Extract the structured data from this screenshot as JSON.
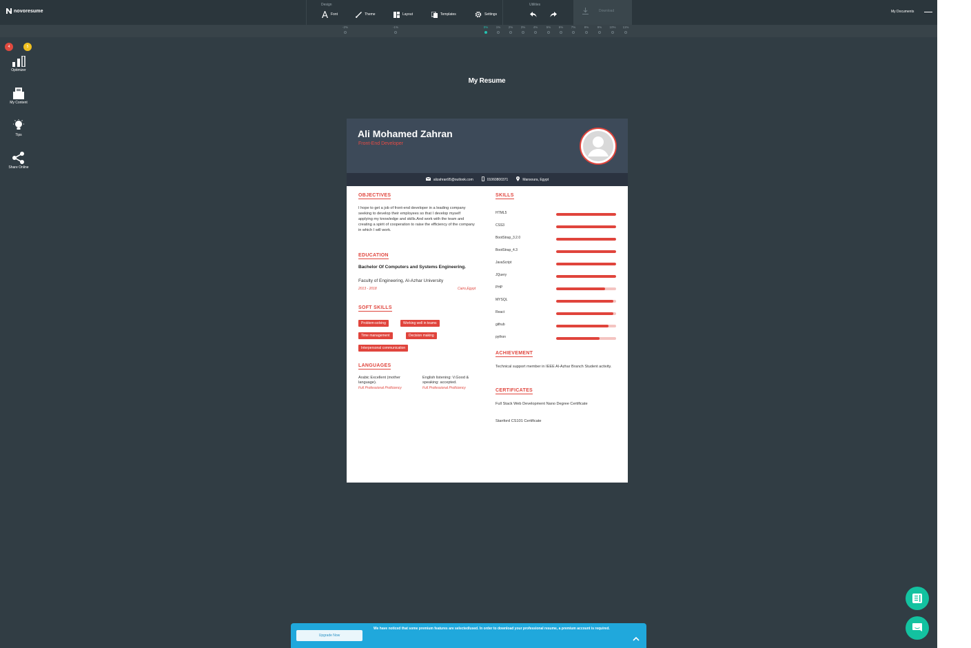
{
  "app": {
    "brand": "novoresume"
  },
  "toolbar": {
    "design_label": "Design",
    "design_items": [
      "Font",
      "Theme",
      "Layout",
      "Templates",
      "Settings"
    ],
    "utilities_label": "Utilities",
    "download_label": "Download",
    "my_documents": "My Documents"
  },
  "spacing_scale": {
    "left_values": [
      "-2%",
      "-1%"
    ],
    "values": [
      "0%",
      "1%",
      "2%",
      "3%",
      "4%",
      "5%",
      "6%",
      "7%",
      "8%",
      "9%",
      "10%",
      "11%"
    ],
    "active_value": "0%"
  },
  "sidebar": {
    "badges": {
      "red": "4",
      "yellow": "5"
    },
    "items": [
      {
        "label": "Optimizer",
        "icon": "bar-chart-icon"
      },
      {
        "label": "My Content",
        "icon": "folder-icon"
      },
      {
        "label": "Tips",
        "icon": "lightbulb-icon"
      },
      {
        "label": "Share Online",
        "icon": "share-icon"
      }
    ]
  },
  "document": {
    "title": "My Resume"
  },
  "resume": {
    "name": "Ali Mohamed Zahran",
    "role": "Front-End Developer",
    "contact": {
      "email": "alizahran95@outlook.com",
      "phone": "01060800371",
      "location": "Mansoura, Egypt"
    },
    "objectives_title": "OBJECTIVES",
    "objectives_text": "I hope to get a job of front-end developer in a leading company seeking to develop their employees so that I develop myself applying my knowledge and skills.And work with the team and creating a spirit of cooperation to raise the efficiency of the company in which I will work.",
    "education_title": "EDUCATION",
    "education": {
      "degree": "Bachelor Of Computers and Systems Engineering.",
      "school": "Faculty of Engineering, Al-Azhar University",
      "dates": "2013 - 2018",
      "location": "Cairo,Egypt"
    },
    "soft_skills_title": "SOFT SKILLS",
    "soft_skills": [
      "Problem-solving",
      "Working well in teams",
      "Time management",
      "Decision making",
      "Interpersonal communication"
    ],
    "languages_title": "LANGUAGES",
    "languages": [
      {
        "text": "Arabic Excellent (mother language).",
        "level": "Full Professional Proficiency"
      },
      {
        "text": "English listening: V.Good & speaking: accepted.",
        "level": "Full Professional Proficiency"
      }
    ],
    "skills_title": "SKILLS",
    "skills": [
      {
        "name": "HTML5",
        "level": 1.0
      },
      {
        "name": "CSS3",
        "level": 1.0
      },
      {
        "name": "BootStrap_3.2.0",
        "level": 1.0
      },
      {
        "name": "BootStrap_4.3",
        "level": 1.0
      },
      {
        "name": "JavaScript",
        "level": 1.0
      },
      {
        "name": "JQuery",
        "level": 1.0
      },
      {
        "name": "PHP",
        "level": 0.82
      },
      {
        "name": "MYSQL",
        "level": 0.95
      },
      {
        "name": "React",
        "level": 0.95
      },
      {
        "name": "github",
        "level": 0.87
      },
      {
        "name": "python",
        "level": 0.72
      }
    ],
    "achievement_title": "ACHIEVEMENT",
    "achievement_text": "Technical support member in IEEE Al-Azhar Branch Student activity.",
    "certificates_title": "CERTIFICATES",
    "certificates": [
      "Full Stack Web Development Nano Degree Certificate",
      "Stanford CS101 Certificate"
    ]
  },
  "banner": {
    "message": "We have noticed that some premium features are selected/used. In order to download your professional resume, a premium account is required.",
    "button": "Upgrade Now"
  },
  "colors": {
    "accent": "#e0443c",
    "teal": "#25c2b1",
    "banner": "#20a8dc"
  }
}
